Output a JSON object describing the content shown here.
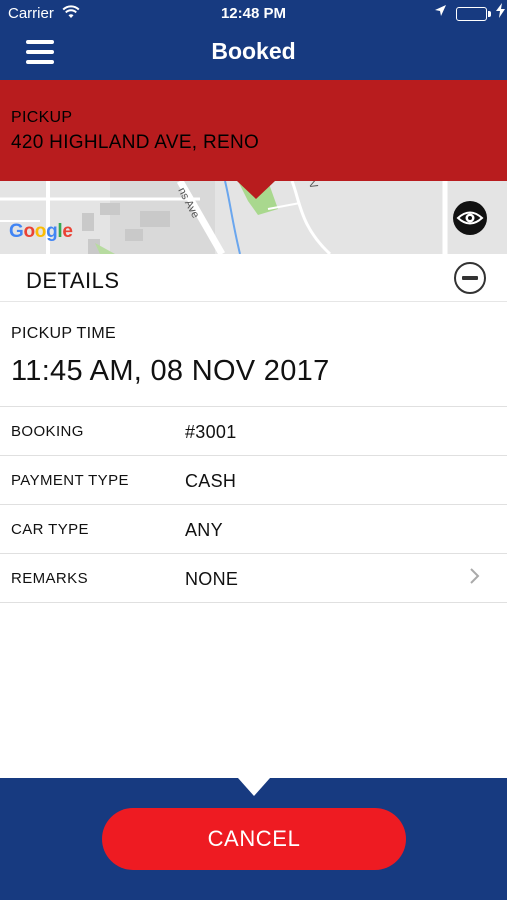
{
  "status_bar": {
    "carrier": "Carrier",
    "time": "12:48 PM"
  },
  "header": {
    "title": "Booked",
    "menu_icon": "hamburger-menu-icon",
    "background_color": "#173a80"
  },
  "pickup": {
    "label": "PICKUP",
    "address": "420 HIGHLAND AVE, RENO",
    "background_color": "#b81c1e"
  },
  "map": {
    "provider_logo": "Google",
    "street_label": "ns Ave",
    "street_label_2": "V",
    "toggle_icon": "eye-icon"
  },
  "details": {
    "title": "DETAILS",
    "collapse_icon": "minus-circle-icon",
    "pickup_time_label": "PICKUP TIME",
    "pickup_time_value": "11:45 AM, 08 NOV 2017",
    "rows": [
      {
        "label": "BOOKING",
        "value": "#3001"
      },
      {
        "label": "PAYMENT TYPE",
        "value": "CASH"
      },
      {
        "label": "CAR TYPE",
        "value": "ANY"
      },
      {
        "label": "REMARKS",
        "value": "NONE"
      }
    ]
  },
  "footer": {
    "cancel_label": "CANCEL",
    "button_color": "#ee1b22"
  }
}
